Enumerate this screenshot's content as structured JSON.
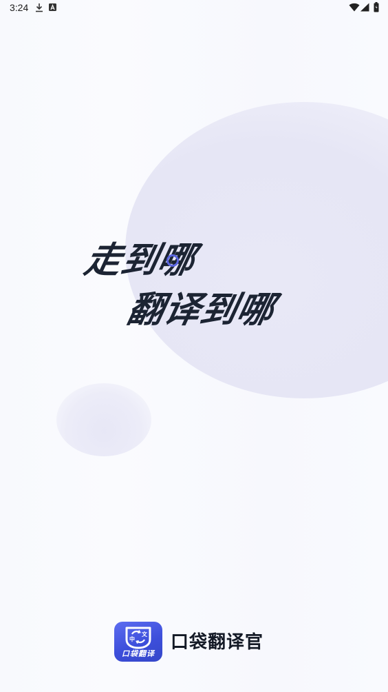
{
  "status_bar": {
    "time": "3:24",
    "icons": [
      "download-icon",
      "a-notification-icon",
      "wifi-icon",
      "signal-icon",
      "battery-icon"
    ]
  },
  "slogan": {
    "line1": "走到哪",
    "line2": "翻译到哪"
  },
  "brand": {
    "app_name": "口袋翻译官",
    "icon_label": "口袋翻译",
    "icon_glyph_top_left": "中",
    "icon_glyph_bottom_right": "文"
  },
  "colors": {
    "background": "#f9f9fd",
    "circle": "#e7e7f6",
    "slogan_text": "#1c2433",
    "accent": "#5b66e0",
    "icon_bg": "#4455e3"
  }
}
